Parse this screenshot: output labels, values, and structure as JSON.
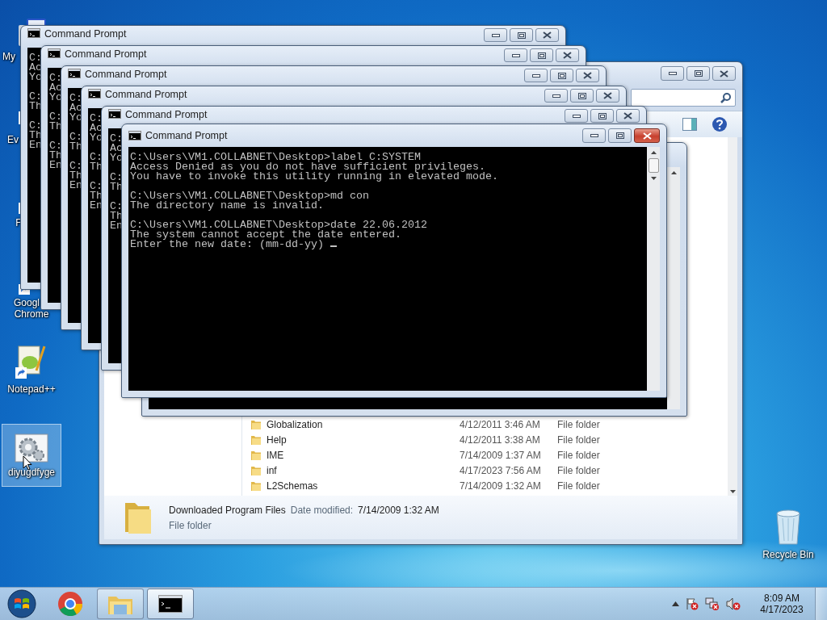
{
  "desktop_icons": [
    {
      "kind": "computer",
      "lines": [
        "My"
      ],
      "selected": false
    },
    {
      "kind": "shortcut",
      "lines": [
        "Ev"
      ],
      "selected": false
    },
    {
      "kind": "app",
      "lines": [
        "F"
      ],
      "selected": false
    },
    {
      "kind": "browser",
      "lines": [
        "Googl",
        "Chrome"
      ],
      "selected": false
    },
    {
      "kind": "notepad",
      "lines": [
        "Notepad++"
      ],
      "selected": false
    },
    {
      "kind": "settings",
      "lines": [
        "diyugdfyge"
      ],
      "selected": true
    }
  ],
  "recycle_bin": {
    "label": "Recycle Bin"
  },
  "explorer": {
    "rows": [
      {
        "name": "Globalization",
        "date": "4/12/2011 3:46 AM",
        "type": "File folder"
      },
      {
        "name": "Help",
        "date": "4/12/2011 3:38 AM",
        "type": "File folder"
      },
      {
        "name": "IME",
        "date": "7/14/2009 1:37 AM",
        "type": "File folder"
      },
      {
        "name": "inf",
        "date": "4/17/2023 7:56 AM",
        "type": "File folder"
      },
      {
        "name": "L2Schemas",
        "date": "7/14/2009 1:32 AM",
        "type": "File folder"
      }
    ],
    "details": {
      "name": "Downloaded Program Files",
      "date_label": "Date modified:",
      "date": "7/14/2009 1:32 AM",
      "type": "File folder"
    }
  },
  "command_windows": [
    {
      "title": "Command Prompt",
      "blocks": [
        [
          "C:",
          "Ac",
          "Yo"
        ],
        [
          "C:",
          "Th"
        ],
        [
          "C:",
          "Th",
          "En"
        ]
      ]
    },
    {
      "title": "Command Prompt",
      "blocks": [
        [
          "C:",
          "Ac",
          "Yo"
        ],
        [
          "C:",
          "Th"
        ],
        [
          "C:",
          "Th",
          "En"
        ]
      ]
    },
    {
      "title": "Command Prompt",
      "blocks": [
        [
          "C:",
          "Ac",
          "Yo"
        ],
        [
          "C:",
          "Th"
        ],
        [
          "C:",
          "Th",
          "En"
        ]
      ]
    },
    {
      "title": "Command Prompt",
      "blocks": [
        [
          "C:",
          "Ac",
          "Yo"
        ],
        [
          "C:",
          "Th"
        ],
        [
          "C:",
          "Th",
          "En"
        ]
      ]
    },
    {
      "title": "Command Prompt",
      "blocks": [
        [
          "C:",
          "Ac",
          "Yo"
        ],
        [
          "C:",
          "Th"
        ],
        [
          "C:",
          "Th",
          "En"
        ]
      ]
    }
  ],
  "active_window": {
    "title": "Command Prompt",
    "cursor": true,
    "blocks": [
      [
        "C:\\Users\\VM1.COLLABNET\\Desktop>label C:SYSTEM",
        "Access Denied as you do not have sufficient privileges.",
        "You have to invoke this utility running in elevated mode."
      ],
      [
        "C:\\Users\\VM1.COLLABNET\\Desktop>md con",
        "The directory name is invalid."
      ],
      [
        "C:\\Users\\VM1.COLLABNET\\Desktop>date 22.06.2012",
        "The system cannot accept the date entered.",
        "Enter the new date: (mm-dd-yy) "
      ]
    ]
  },
  "taskbar": {
    "buttons": [
      {
        "kind": "browser",
        "running": false,
        "active": false
      },
      {
        "kind": "folders",
        "running": true,
        "active": false
      },
      {
        "kind": "console",
        "running": true,
        "active": true
      }
    ],
    "tray_icons": [
      {
        "kind": "arrow"
      },
      {
        "kind": "flag"
      },
      {
        "kind": "network"
      },
      {
        "kind": "volume"
      }
    ],
    "time": "8:09 AM",
    "date": "4/17/2023"
  }
}
